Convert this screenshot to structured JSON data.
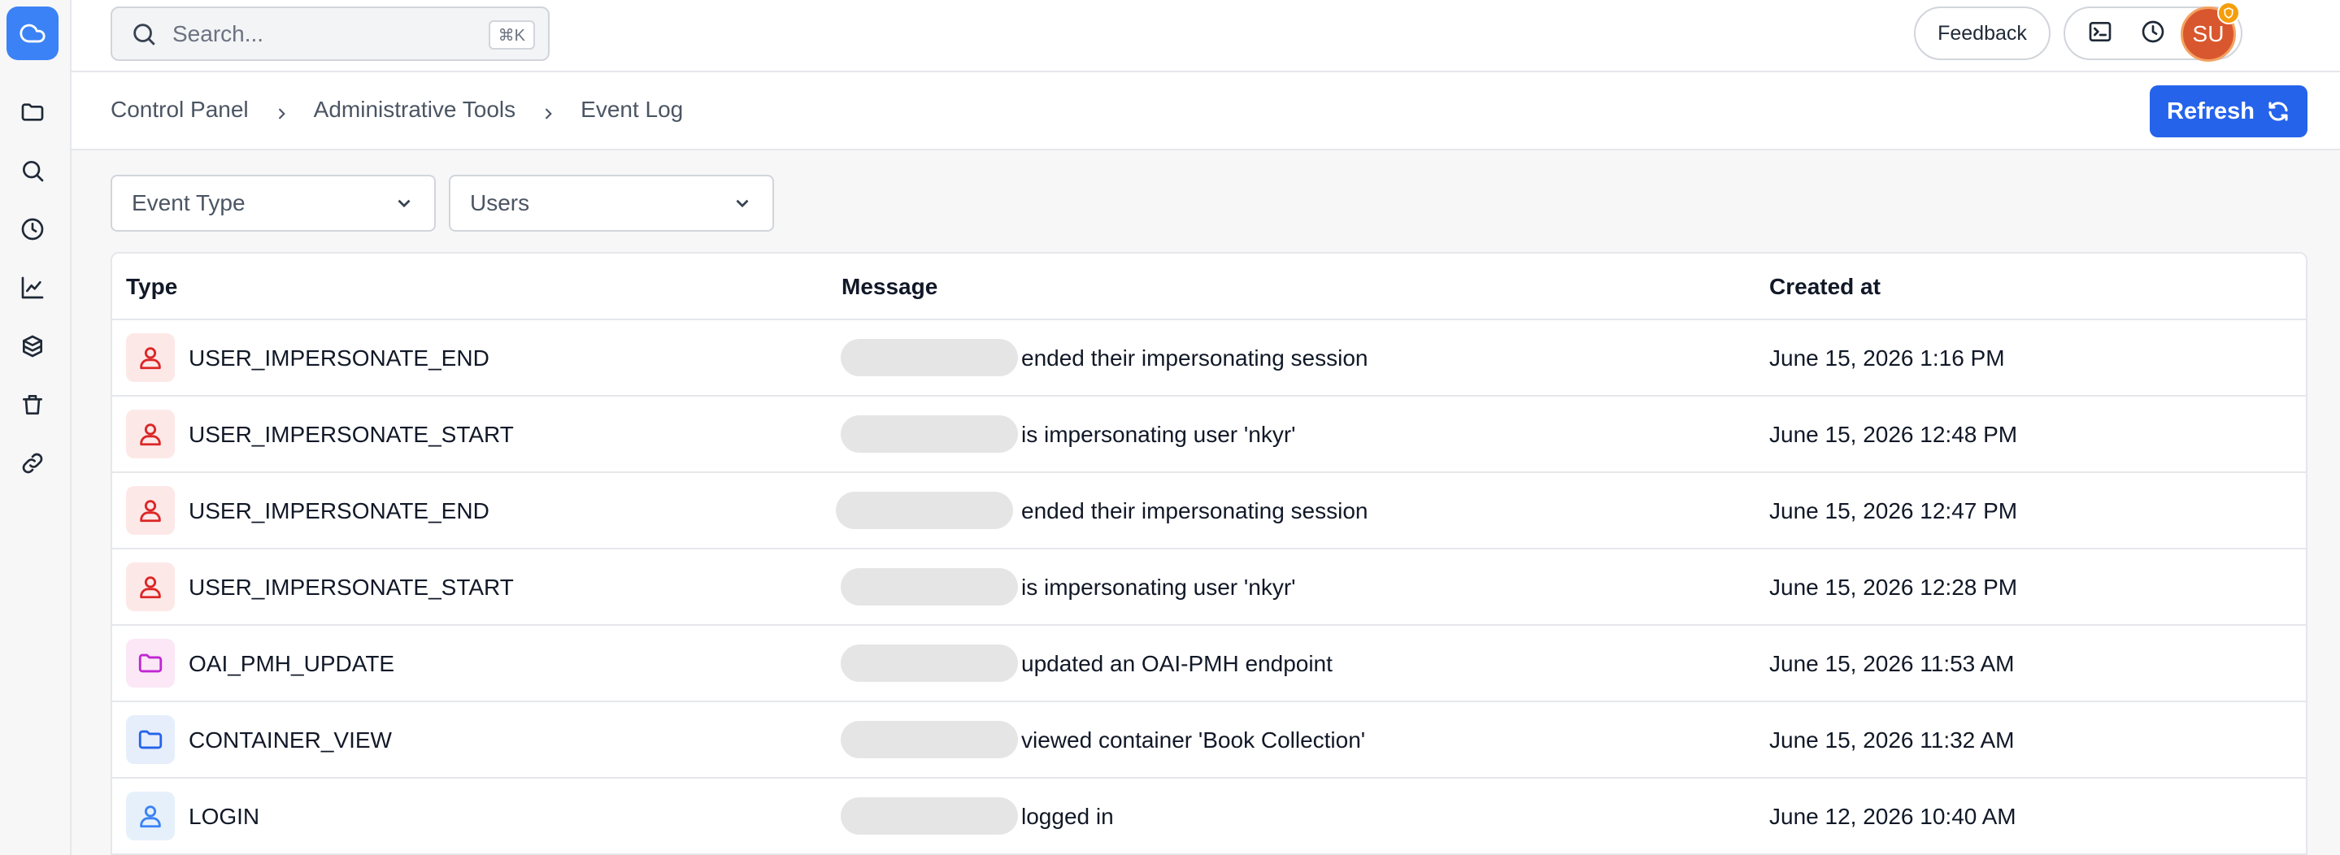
{
  "search": {
    "placeholder": "Search...",
    "shortcut": "⌘K"
  },
  "topbar": {
    "feedback_label": "Feedback",
    "avatar_initials": "SU"
  },
  "breadcrumb": [
    "Control Panel",
    "Administrative Tools",
    "Event Log"
  ],
  "refresh_label": "Refresh",
  "filters": {
    "event_type": "Event Type",
    "users": "Users"
  },
  "table": {
    "headers": {
      "type": "Type",
      "message": "Message",
      "created": "Created at"
    },
    "rows": [
      {
        "type": "USER_IMPERSONATE_END",
        "icon": "user-icon",
        "message": "ended their impersonating session",
        "created": "June 15, 2026 1:16 PM"
      },
      {
        "type": "USER_IMPERSONATE_START",
        "icon": "user-icon",
        "message": "is impersonating user 'nkyr'",
        "created": "June 15, 2026 12:48 PM"
      },
      {
        "type": "USER_IMPERSONATE_END",
        "icon": "user-icon",
        "message": "ended their impersonating session",
        "created": "June 15, 2026 12:47 PM"
      },
      {
        "type": "USER_IMPERSONATE_START",
        "icon": "user-icon",
        "message": "is impersonating user 'nkyr'",
        "created": "June 15, 2026 12:28 PM"
      },
      {
        "type": "OAI_PMH_UPDATE",
        "icon": "folder-icon",
        "message": "updated an OAI-PMH endpoint",
        "created": "June 15, 2026 11:53 AM"
      },
      {
        "type": "CONTAINER_VIEW",
        "icon": "folder-icon",
        "message": "viewed container 'Book Collection'",
        "created": "June 15, 2026 11:32 AM"
      },
      {
        "type": "LOGIN",
        "icon": "user-icon",
        "message": "logged in",
        "created": "June 12, 2026 10:40 AM"
      }
    ]
  },
  "colors": {
    "accent": "#2563eb",
    "logo": "#3b82f6",
    "impersonate_icon": "#dc2626",
    "impersonate_bg": "#fde8e8",
    "oai_icon": "#c026d3",
    "oai_bg": "#fbe7f6",
    "container_icon": "#2563eb",
    "container_bg": "#e6eefb",
    "login_icon": "#3b82f6",
    "login_bg": "#e6f0fb"
  }
}
